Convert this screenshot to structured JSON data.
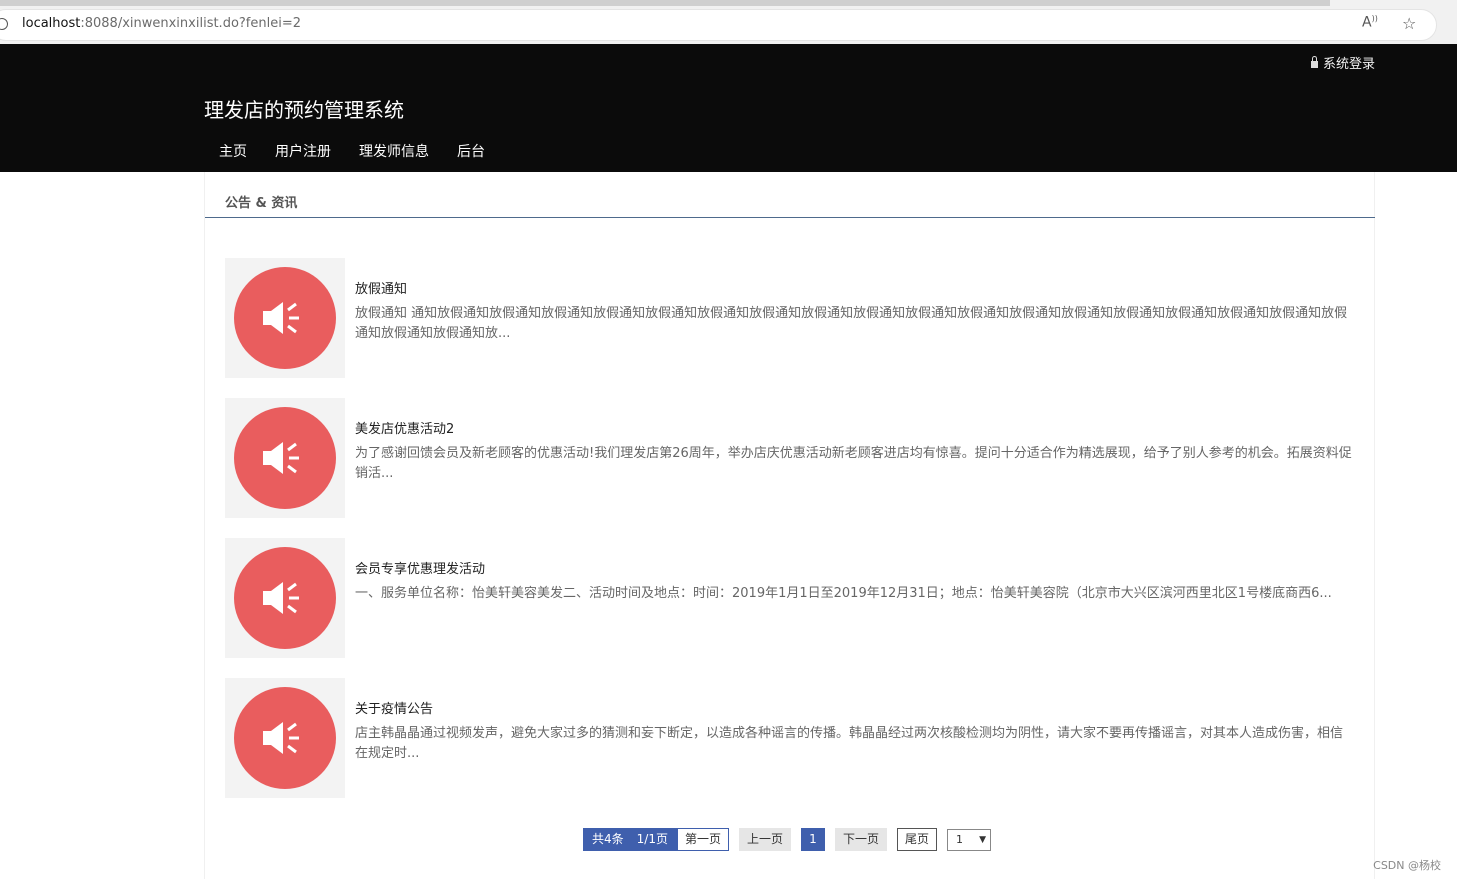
{
  "browser": {
    "url_host": "localhost",
    "url_rest": ":8088/xinwenxinxilist.do?fenlei=2"
  },
  "header": {
    "login_label": "系统登录",
    "site_title": "理发店的预约管理系统",
    "nav": [
      "主页",
      "用户注册",
      "理发师信息",
      "后台"
    ]
  },
  "section": {
    "title": "公告 & 资讯"
  },
  "news": [
    {
      "title": "放假通知",
      "summary": "放假通知 通知放假通知放假通知放假通知放假通知放假通知放假通知放假通知放假通知放假通知放假通知放假通知放假通知放假通知放假通知放假通知放假通知放假通知放假通知放假通知放假通知放..."
    },
    {
      "title": "美发店优惠活动2",
      "summary": "为了感谢回馈会员及新老顾客的优惠活动!我们理发店第26周年，举办店庆优惠活动新老顾客进店均有惊喜。提问十分适合作为精选展现，给予了别人参考的机会。拓展资料促销活..."
    },
    {
      "title": "会员专享优惠理发活动",
      "summary": "一、服务单位名称：怡美轩美容美发二、活动时间及地点：时间：2019年1月1日至2019年12月31日；地点：怡美轩美容院（北京市大兴区滨河西里北区1号楼底商西6..."
    },
    {
      "title": "关于疫情公告",
      "summary": "店主韩晶晶通过视频发声，避免大家过多的猜测和妄下断定，以造成各种谣言的传播。韩晶晶经过两次核酸检测均为阴性，请大家不要再传播谣言，对其本人造成伤害，相信在规定时..."
    }
  ],
  "pager": {
    "total": "共4条",
    "pages": "1/1页",
    "first": "第一页",
    "prev": "上一页",
    "current": "1",
    "next": "下一页",
    "last": "尾页",
    "select_value": "1"
  },
  "watermark": "CSDN @杨校",
  "colors": {
    "header_bg": "#0b0b0b",
    "accent": "#3f5fad",
    "icon_circle": "#e95d5e"
  }
}
